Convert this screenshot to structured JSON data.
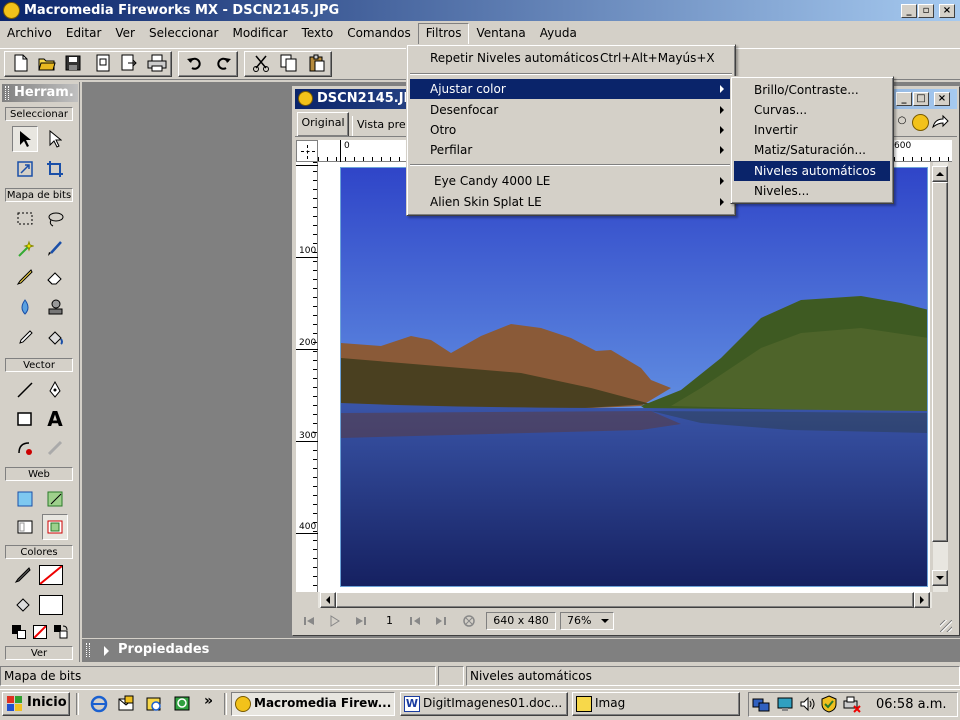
{
  "window": {
    "title": "Macromedia Fireworks MX - DSCN2145.JPG"
  },
  "menubar": [
    "Archivo",
    "Editar",
    "Ver",
    "Seleccionar",
    "Modificar",
    "Texto",
    "Comandos",
    "Filtros",
    "Ventana",
    "Ayuda"
  ],
  "filters_menu": {
    "repeat_label": "Repetir Niveles automáticos",
    "repeat_shortcut": "Ctrl+Alt+Mayús+X",
    "items": [
      "Ajustar color",
      "Desenfocar",
      "Otro",
      "Perfilar"
    ],
    "plugins": [
      "Eye Candy 4000 LE",
      "Alien Skin Splat LE"
    ]
  },
  "color_submenu": {
    "items": [
      "Brillo/Contraste...",
      "Curvas...",
      "Invertir",
      "Matiz/Saturación...",
      "Niveles automáticos",
      "Niveles..."
    ],
    "selected_index": 4
  },
  "tools_panel": {
    "title": "Herram.",
    "sections": [
      "Seleccionar",
      "Mapa de bits",
      "Vector",
      "Web",
      "Colores",
      "Ver"
    ]
  },
  "doc": {
    "title": "DSCN2145.JPG",
    "tabs": [
      "Original",
      "Vista previ"
    ],
    "ruler_top": [
      "0",
      "600"
    ],
    "ruler_left": [
      "100",
      "200",
      "300",
      "400"
    ],
    "frame": "1",
    "size": "640 x 480",
    "zoom": "76%"
  },
  "properties": {
    "title": "Propiedades"
  },
  "statusbar": {
    "left": "Mapa de bits",
    "right": "Niveles automáticos"
  },
  "taskbar": {
    "start": "Inicio",
    "chevron": "»",
    "tasks": [
      "Macromedia Firew...",
      "DigitImagenes01.doc...",
      "Imag"
    ],
    "clock": "06:58 a.m."
  },
  "colors": {
    "title_start": "#0a246a",
    "title_end": "#a6caf0",
    "face": "#d4d0c8",
    "highlight": "#0a246a",
    "workspace": "#808080"
  }
}
